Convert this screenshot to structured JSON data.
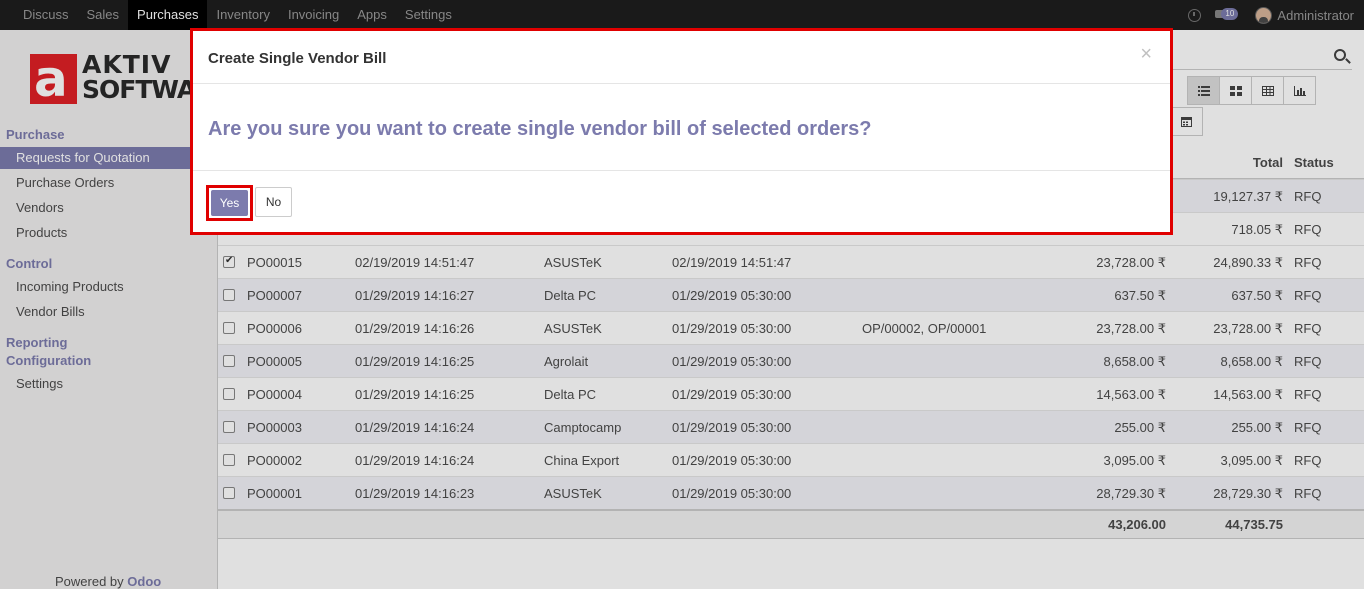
{
  "navbar": {
    "apps": [
      "Discuss",
      "Sales",
      "Purchases",
      "Inventory",
      "Invoicing",
      "Apps",
      "Settings"
    ],
    "active_app": "Purchases",
    "chat_badge": "10",
    "user_name": "Administrator"
  },
  "sidebar": {
    "logo_line1": "AKTIV",
    "logo_line2": "SOFTWARE",
    "logo_mark": "a",
    "sections": [
      {
        "title": "Purchase",
        "items": [
          "Requests for Quotation",
          "Purchase Orders",
          "Vendors",
          "Products"
        ]
      },
      {
        "title": "Control",
        "items": [
          "Incoming Products",
          "Vendor Bills"
        ]
      },
      {
        "title": "Reporting",
        "items": []
      },
      {
        "title": "Configuration",
        "items": [
          "Settings"
        ]
      }
    ],
    "powered_prefix": "Powered by ",
    "powered_brand": "Odoo"
  },
  "list": {
    "headers": {
      "total": "Total",
      "status": "Status"
    },
    "partial_rows": [
      {
        "total": "19,127.37 ₹",
        "status": "RFQ"
      },
      {
        "total": "718.05 ₹",
        "status": "RFQ"
      }
    ],
    "rows": [
      {
        "ref": "PO00015",
        "date": "02/19/2019 14:51:47",
        "vendor": "ASUSTeK",
        "scheduled": "02/19/2019 14:51:47",
        "source": "",
        "untaxed": "23,728.00 ₹",
        "total": "24,890.33 ₹",
        "status": "RFQ",
        "checked": true
      },
      {
        "ref": "PO00007",
        "date": "01/29/2019 14:16:27",
        "vendor": "Delta PC",
        "scheduled": "01/29/2019 05:30:00",
        "source": "",
        "untaxed": "637.50 ₹",
        "total": "637.50 ₹",
        "status": "RFQ",
        "checked": false
      },
      {
        "ref": "PO00006",
        "date": "01/29/2019 14:16:26",
        "vendor": "ASUSTeK",
        "scheduled": "01/29/2019 05:30:00",
        "source": "OP/00002, OP/00001",
        "untaxed": "23,728.00 ₹",
        "total": "23,728.00 ₹",
        "status": "RFQ",
        "checked": false
      },
      {
        "ref": "PO00005",
        "date": "01/29/2019 14:16:25",
        "vendor": "Agrolait",
        "scheduled": "01/29/2019 05:30:00",
        "source": "",
        "untaxed": "8,658.00 ₹",
        "total": "8,658.00 ₹",
        "status": "RFQ",
        "checked": false
      },
      {
        "ref": "PO00004",
        "date": "01/29/2019 14:16:25",
        "vendor": "Delta PC",
        "scheduled": "01/29/2019 05:30:00",
        "source": "",
        "untaxed": "14,563.00 ₹",
        "total": "14,563.00 ₹",
        "status": "RFQ",
        "checked": false
      },
      {
        "ref": "PO00003",
        "date": "01/29/2019 14:16:24",
        "vendor": "Camptocamp",
        "scheduled": "01/29/2019 05:30:00",
        "source": "",
        "untaxed": "255.00 ₹",
        "total": "255.00 ₹",
        "status": "RFQ",
        "checked": false
      },
      {
        "ref": "PO00002",
        "date": "01/29/2019 14:16:24",
        "vendor": "China Export",
        "scheduled": "01/29/2019 05:30:00",
        "source": "",
        "untaxed": "3,095.00 ₹",
        "total": "3,095.00 ₹",
        "status": "RFQ",
        "checked": false
      },
      {
        "ref": "PO00001",
        "date": "01/29/2019 14:16:23",
        "vendor": "ASUSTeK",
        "scheduled": "01/29/2019 05:30:00",
        "source": "",
        "untaxed": "28,729.30 ₹",
        "total": "28,729.30 ₹",
        "status": "RFQ",
        "checked": false
      }
    ],
    "footer": {
      "untaxed_sum": "43,206.00",
      "total_sum": "44,735.75"
    }
  },
  "modal": {
    "title": "Create Single Vendor Bill",
    "close": "×",
    "question": "Are you sure you want to create single vendor bill of selected orders?",
    "yes_label": "Yes",
    "no_label": "No"
  },
  "colors": {
    "accent": "#7c7bad",
    "highlight_border": "#e00000",
    "navbar": "#1e1e1e"
  }
}
